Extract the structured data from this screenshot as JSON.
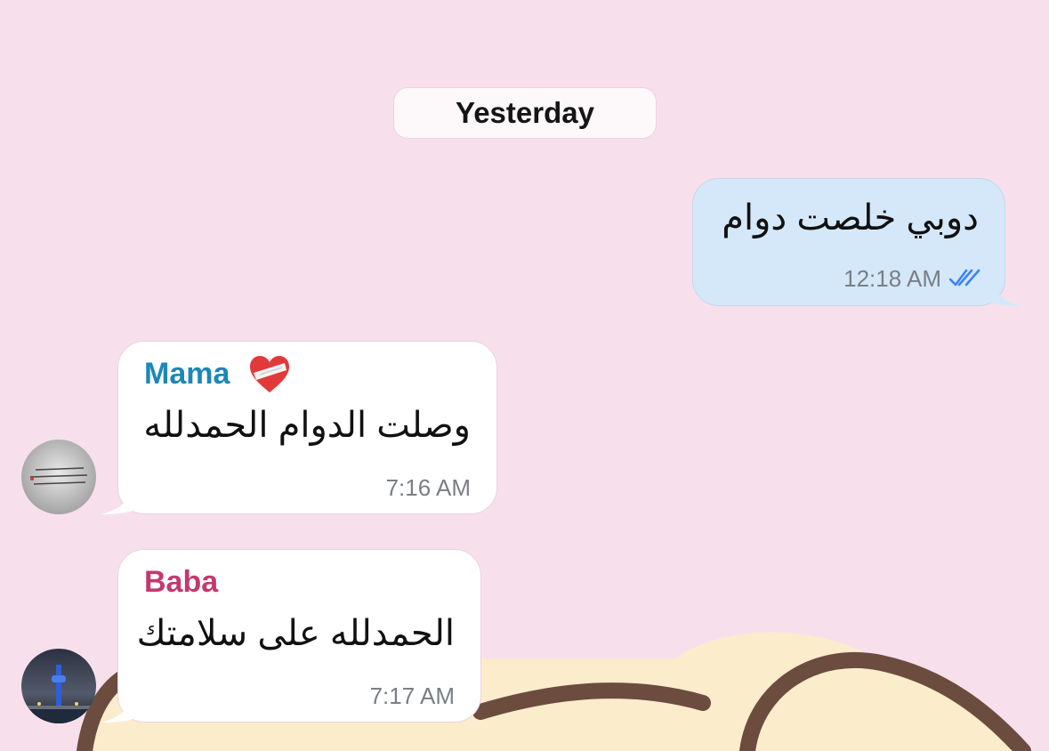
{
  "date_separator": "Yesterday",
  "messages": [
    {
      "direction": "outgoing",
      "text": "دوبي خلصت دوام",
      "time": "12:18 AM",
      "status_icon": "double-check-read-icon"
    },
    {
      "direction": "incoming",
      "sender": "Mama",
      "sender_emoji": "❤️‍🩹",
      "sender_color": "#1c87b8",
      "text": "وصلت الدوام الحمدلله",
      "time": "7:16 AM",
      "avatar_icon": "quote-image-avatar-icon"
    },
    {
      "direction": "incoming",
      "sender": "Baba",
      "sender_color": "#c4386e",
      "text": "الحمدلله على سلامتك",
      "time": "7:17 AM",
      "avatar_icon": "night-tower-avatar-icon"
    }
  ],
  "colors": {
    "background": "#f7e0ec",
    "outgoing_bubble": "#d4e8f9",
    "incoming_bubble": "#ffffff",
    "read_check": "#3b82f6"
  }
}
